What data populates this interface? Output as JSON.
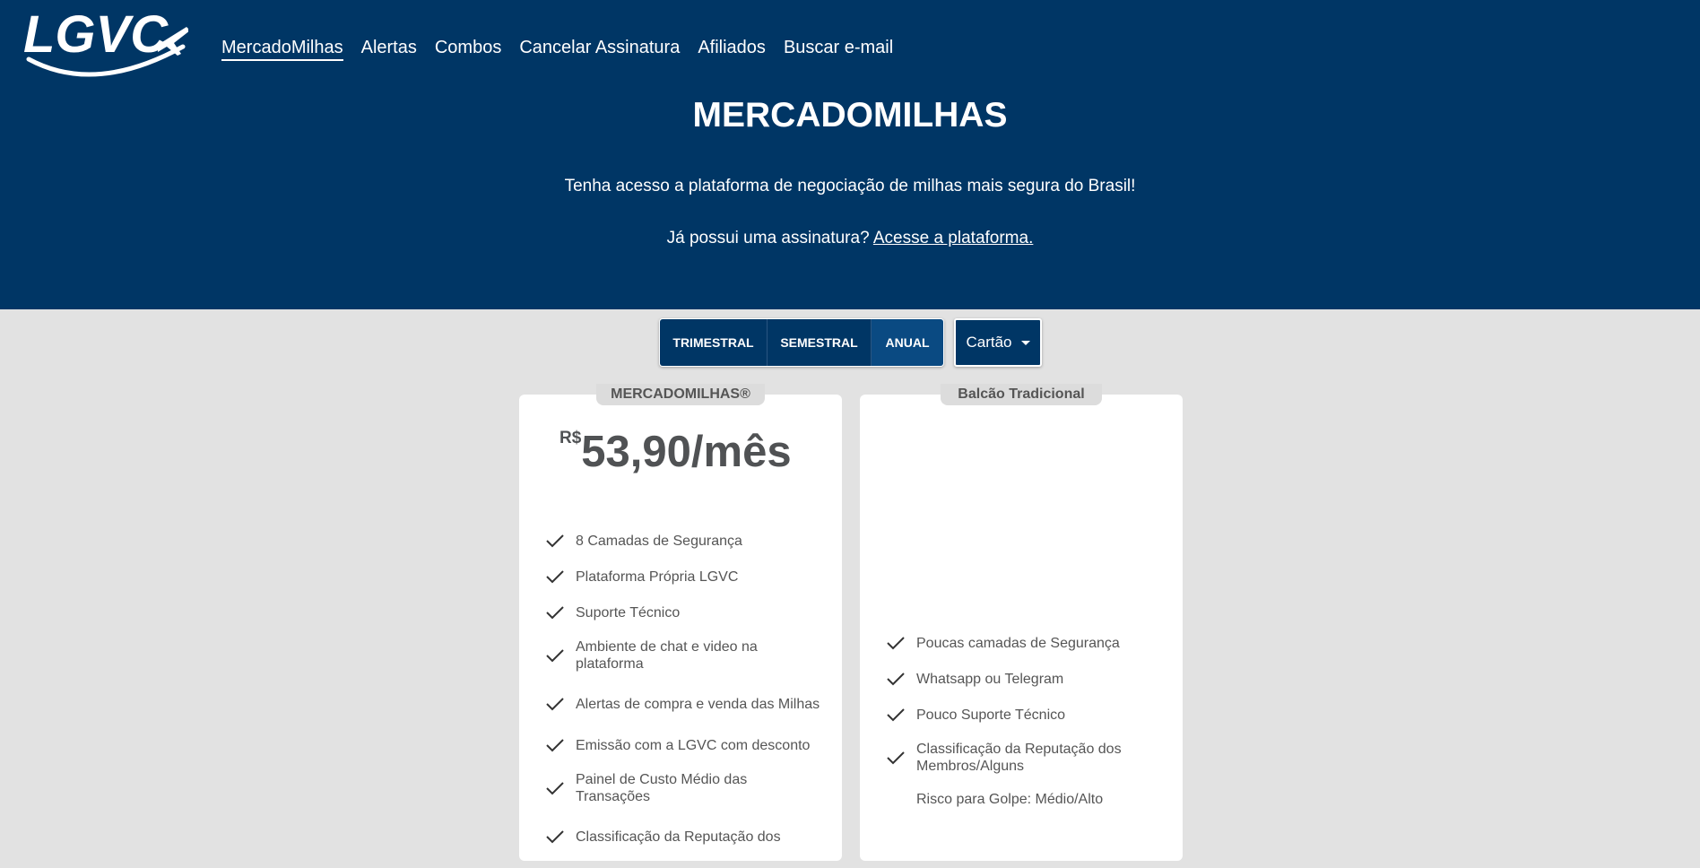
{
  "header": {
    "logo_text": "LGVC",
    "nav": [
      {
        "label": "MercadoMilhas",
        "active": true
      },
      {
        "label": "Alertas"
      },
      {
        "label": "Combos"
      },
      {
        "label": "Cancelar Assinatura"
      },
      {
        "label": "Afiliados"
      },
      {
        "label": "Buscar e-mail"
      }
    ],
    "title": "MERCADOMILHAS",
    "subtitle": "Tenha acesso a plataforma de negociação de milhas mais segura do Brasil!",
    "login_prompt": "Já possui uma assinatura?",
    "login_link": "Acesse a plataforma."
  },
  "period": {
    "options": [
      "TRIMESTRAL",
      "SEMESTRAL",
      "ANUAL"
    ],
    "selected": "ANUAL"
  },
  "payment": {
    "selected": "Cartão"
  },
  "plans": {
    "mercado": {
      "tab": "MERCADOMILHAS®",
      "currency": "R$",
      "price": "53,90/mês",
      "features": [
        "8 Camadas de Segurança",
        "Plataforma Própria LGVC",
        "Suporte Técnico",
        "Ambiente de chat e video na plataforma",
        "Alertas de compra e venda das Milhas",
        "Emissão com a LGVC com desconto",
        "Painel de Custo Médio das Transações",
        "Classificação da Reputação dos"
      ]
    },
    "balcao": {
      "tab": "Balcão Tradicional",
      "features": [
        "Poucas camadas de Segurança",
        "Whatsapp ou Telegram",
        "Pouco Suporte Técnico",
        "Classificação da Reputação dos Membros/Alguns",
        "Risco para Golpe: Médio/Alto"
      ]
    }
  },
  "colors": {
    "brand": "#003665",
    "background": "#e2e2e2",
    "card": "#ffffff",
    "text": "#555555"
  }
}
